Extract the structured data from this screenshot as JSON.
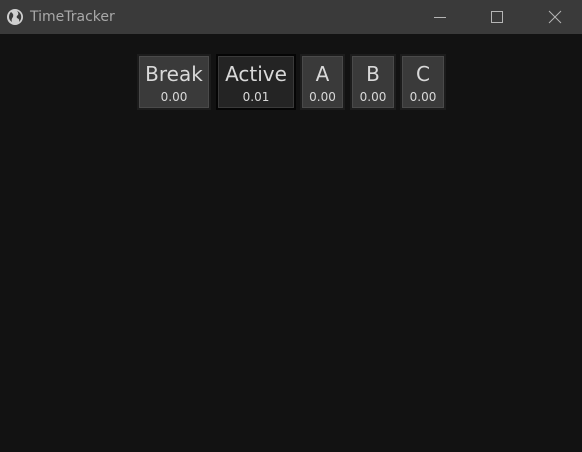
{
  "window": {
    "title": "TimeTracker",
    "app_icon": "globe-icon",
    "controls": {
      "minimize_icon": "minimize-icon",
      "maximize_icon": "maximize-icon",
      "close_icon": "close-icon"
    }
  },
  "categories": [
    {
      "label": "Break",
      "time": "0.00"
    },
    {
      "label": "Active",
      "time": "0.01",
      "selected": true
    },
    {
      "label": "A",
      "time": "0.00"
    },
    {
      "label": "B",
      "time": "0.00"
    },
    {
      "label": "C",
      "time": "0.00"
    }
  ],
  "colors": {
    "background": "#121212",
    "titlebar": "#3a3a3a",
    "button": "#3a3a3a",
    "button_active": "#242424",
    "text": "#d9d9d9"
  }
}
